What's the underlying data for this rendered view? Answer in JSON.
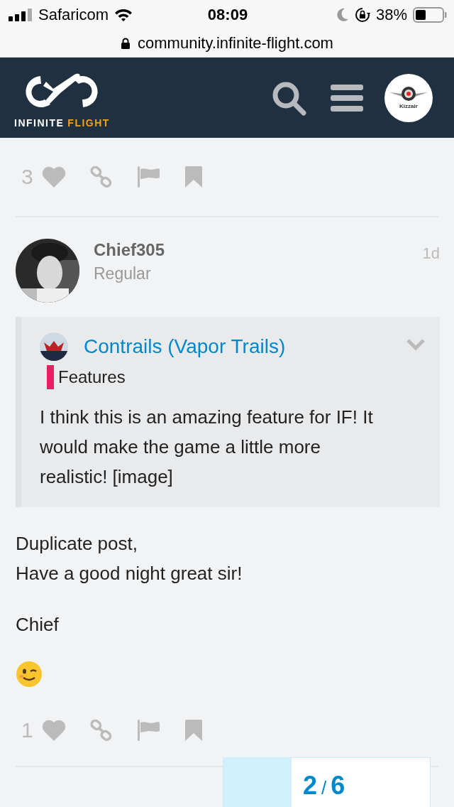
{
  "status_bar": {
    "carrier": "Safaricom",
    "time": "08:09",
    "battery": "38%"
  },
  "url_bar": {
    "url": "community.infinite-flight.com"
  },
  "header": {
    "logo_text_1": "INFINITE",
    "logo_text_2": "FLIGHT",
    "avatar_text": "Kizzair"
  },
  "prev_post_actions": {
    "likes": "3"
  },
  "post": {
    "author": "Chief305",
    "title": "Regular",
    "age": "1d",
    "quote": {
      "topic": "Contrails (Vapor Trails)",
      "category": {
        "name": "Features",
        "color": "#e91e63"
      },
      "text": "I think this is an amazing feature for IF! It would make the game a little more realistic! [image]",
      "expanded": false
    },
    "paragraphs": [
      "Duplicate post,\nHave a good night great sir!",
      "Chief"
    ],
    "likes": "1"
  },
  "progress": {
    "current": "2",
    "separator": "/",
    "total": "6",
    "level": 0.33
  }
}
